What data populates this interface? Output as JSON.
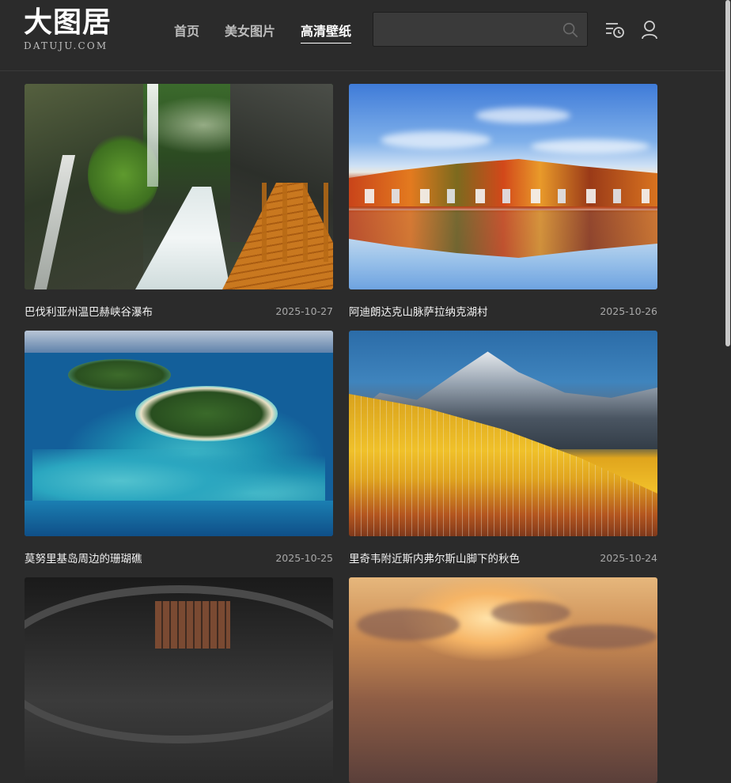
{
  "header": {
    "logo_cn": "大图居",
    "logo_en": "DATUJU.COM",
    "nav": [
      {
        "label": "首页",
        "active": false
      },
      {
        "label": "美女图片",
        "active": false
      },
      {
        "label": "高清壁纸",
        "active": true
      }
    ],
    "search": {
      "placeholder": ""
    },
    "icons": [
      "search-icon",
      "history-icon",
      "user-icon"
    ]
  },
  "cards": [
    {
      "title": "巴伐利亚州温巴赫峡谷瀑布",
      "date": "2025-10-27"
    },
    {
      "title": "阿迪朗达克山脉萨拉纳克湖村",
      "date": "2025-10-26"
    },
    {
      "title": "莫努里基岛周边的珊瑚礁",
      "date": "2025-10-25"
    },
    {
      "title": "里奇韦附近斯内弗尔斯山脚下的秋色",
      "date": "2025-10-24"
    }
  ],
  "colors": {
    "background": "#2b2b2b",
    "text": "#f2f2f2",
    "muted": "#a8a8a8"
  }
}
